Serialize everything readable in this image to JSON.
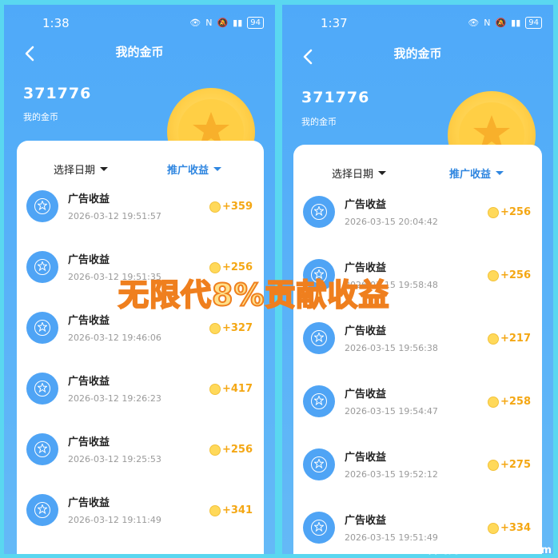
{
  "overlay_text": "无限代8%贡献收益",
  "watermark": "586首码网 www.h586.com",
  "left": {
    "status_time": "1:38",
    "battery": "94",
    "nav_title": "我的金币",
    "balance": "371776",
    "balance_label": "我的金币",
    "filter_date": "选择日期",
    "filter_type": "推广收益",
    "rows": [
      {
        "title": "广告收益",
        "time": "2026-03-12 19:51:57",
        "amount": "+359"
      },
      {
        "title": "广告收益",
        "time": "2026-03-12 19:51:35",
        "amount": "+256"
      },
      {
        "title": "广告收益",
        "time": "2026-03-12 19:46:06",
        "amount": "+327"
      },
      {
        "title": "广告收益",
        "time": "2026-03-12 19:26:23",
        "amount": "+417"
      },
      {
        "title": "广告收益",
        "time": "2026-03-12 19:25:53",
        "amount": "+256"
      },
      {
        "title": "广告收益",
        "time": "2026-03-12 19:11:49",
        "amount": "+341"
      }
    ]
  },
  "right": {
    "status_time": "1:37",
    "battery": "94",
    "nav_title": "我的金币",
    "balance": "371776",
    "balance_label": "我的金币",
    "filter_date": "选择日期",
    "filter_type": "推广收益",
    "rows": [
      {
        "title": "广告收益",
        "time": "2026-03-15 20:04:42",
        "amount": "+256"
      },
      {
        "title": "广告收益",
        "time": "2026-03-15 19:58:48",
        "amount": "+256"
      },
      {
        "title": "广告收益",
        "time": "2026-03-15 19:56:38",
        "amount": "+217"
      },
      {
        "title": "广告收益",
        "time": "2026-03-15 19:54:47",
        "amount": "+258"
      },
      {
        "title": "广告收益",
        "time": "2026-03-15 19:52:12",
        "amount": "+275"
      },
      {
        "title": "广告收益",
        "time": "2026-03-15 19:51:49",
        "amount": "+334"
      }
    ]
  }
}
